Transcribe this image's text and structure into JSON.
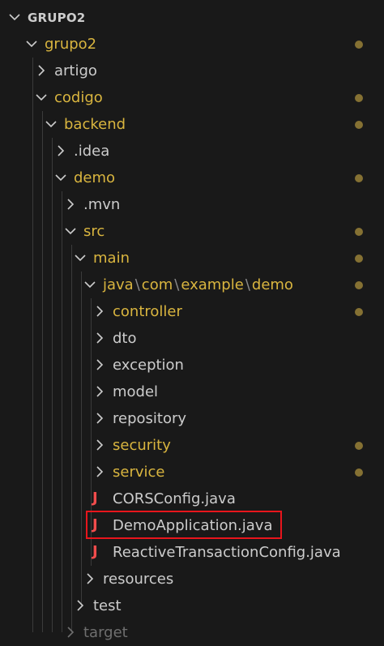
{
  "explorer": {
    "section_title": "GRUPO2"
  },
  "tree": {
    "grupo2": "grupo2",
    "artigo": "artigo",
    "codigo": "codigo",
    "backend": "backend",
    "idea": ".idea",
    "demo": "demo",
    "mvn": ".mvn",
    "src": "src",
    "main": "main",
    "java_path": [
      "java",
      "com",
      "example",
      "demo"
    ],
    "controller": "controller",
    "dto": "dto",
    "exception": "exception",
    "model": "model",
    "repository": "repository",
    "security": "security",
    "service": "service",
    "cors_config": "CORSConfig.java",
    "demo_application": "DemoApplication.java",
    "reactive_config": "ReactiveTransactionConfig.java",
    "resources": "resources",
    "test": "test",
    "target": "target"
  },
  "icons": {
    "java_file_icon_glyph": "J"
  },
  "colors": {
    "background": "#191919",
    "modified_text": "#d9b53f",
    "plain_text": "#cccccc",
    "modified_dot": "#857133",
    "java_icon": "#f14c4c",
    "highlight_border": "#e8151c"
  }
}
